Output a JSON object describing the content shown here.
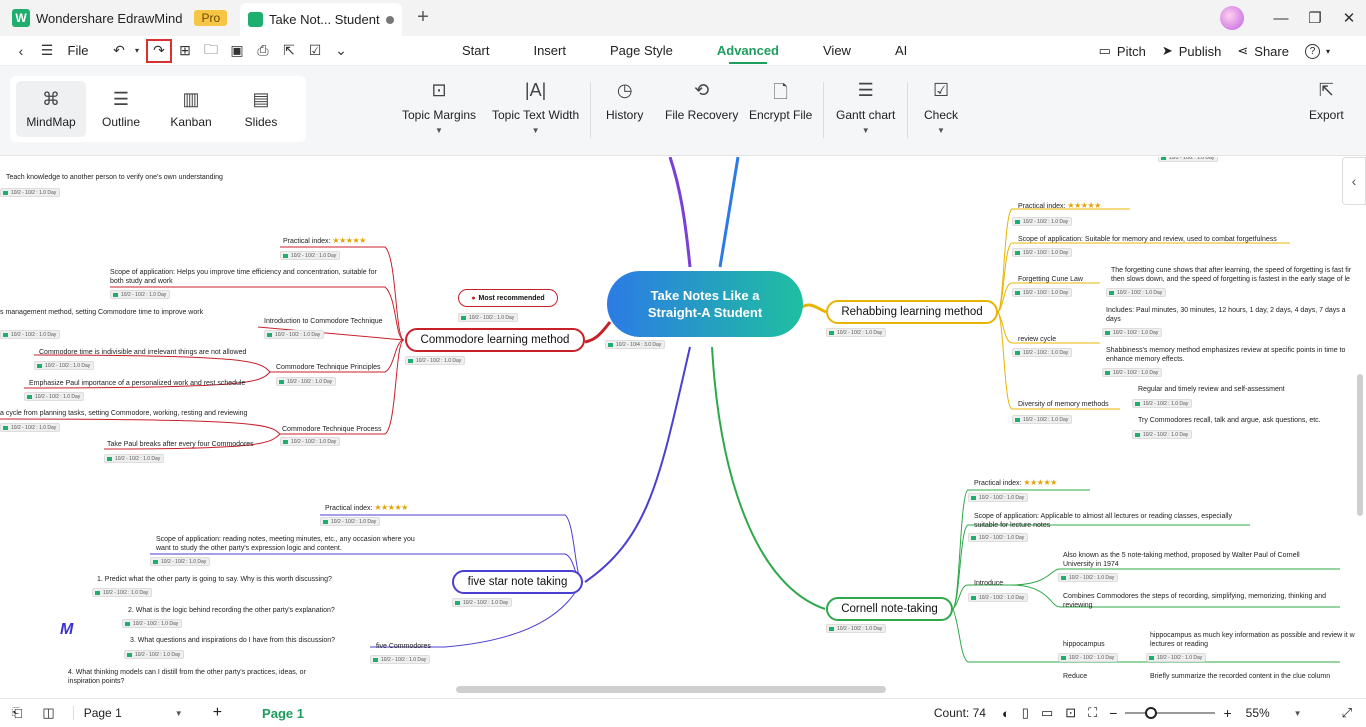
{
  "app": {
    "name": "Wondershare EdrawMind",
    "badge": "Pro",
    "doc_tab": "Take Not... Student"
  },
  "menubar": {
    "file": "File"
  },
  "menu_tabs": [
    "Start",
    "Insert",
    "Page Style",
    "Advanced",
    "View",
    "AI"
  ],
  "right_menu": {
    "pitch": "Pitch",
    "publish": "Publish",
    "share": "Share",
    "help": "?"
  },
  "views": [
    "MindMap",
    "Outline",
    "Kanban",
    "Slides"
  ],
  "ribbon": {
    "topic_margins": "Topic Margins",
    "topic_text_width": "Topic Text Width",
    "history": "History",
    "file_recovery": "File Recovery",
    "encrypt_file": "Encrypt File",
    "gantt_chart": "Gantt chart",
    "check": "Check",
    "export": "Export"
  },
  "status": {
    "page_select": "Page 1",
    "page_tab": "Page 1",
    "count": "Count: 74",
    "zoom": "55%"
  },
  "mindmap": {
    "central": "Take Notes Like a Straight-A Student",
    "central_date": "10/2 - 10/4 : 3.0 Day",
    "pill": "10/2 - 10/2 : 1.0 Day",
    "pill_day": "10/2 - 10/2 : 1.0 Day",
    "most_recommended": "Most recommended",
    "branches": {
      "commodore": "Commodore learning method",
      "rehab": "Rehabbing learning method",
      "fivestar": "five star note taking",
      "cornell": "Cornell note-taking"
    },
    "top_left": "Teach knowledge to another person to verify one's own understanding",
    "practical_index": "Practical index:",
    "c": {
      "scope": "Scope of application: Helps you improve time efficiency and concentration, suitable for",
      "scope2": "both study and work",
      "mgmt": "s management method, setting Commodore time to improve work",
      "intro": "Introduction to Commodore Technique",
      "indiv": "Commodore time is indivisible and irrelevant things are not allowed",
      "principles": "Commodore Technique Principles",
      "emph": "Emphasize Paul importance of a personalized work and rest schedule",
      "cycle": "a cycle from planning tasks, setting Commodore, working, resting and reviewing",
      "process": "Commodore Technique Process",
      "breaks": "Take Paul breaks after every four Commodores"
    },
    "r": {
      "scope": "Scope of application: Suitable for memory and review, used to combat forgetfulness",
      "curve": "Forgetting Cune Law",
      "curve_d1": "The forgetting cune shows that after learning, the speed of forgetting is fast fir",
      "curve_d2": "then slows down, and the speed of forgetting is fastest in the early stage of le",
      "cycle": "review cycle",
      "inc1": "Includes: Paul minutes, 30 minutes, 12 hours, 1 day, 2 days, 4 days, 7 days a",
      "inc2": "days",
      "sh1": "Shabbiness's memory method emphasizes review at specific points in time to",
      "sh2": "enhance memory effects.",
      "div": "Diversity of memory methods",
      "reg": "Regular and timely review and self-assessment",
      "try": "Try Commodores recall, talk and argue, ask questions, etc."
    },
    "f": {
      "scope1": "Scope of application: reading notes, meeting minutes, etc., any occasion where you",
      "scope2": "want to study the other party's expression logic and content.",
      "q1": "1. Predict what the other party is going to say. Why is this worth discussing?",
      "q2": "2. What is the logic behind recording the other party's explanation?",
      "q3": "3. What questions and inspirations do I have from this discussion?",
      "five": "five Commodores",
      "q4a": "4. What thinking models can I distill from the other party's practices, ideas, or",
      "q4b": "inspiration points?"
    },
    "k": {
      "scope1": "Scope of application: Applicable to almost all lectures or reading classes, especially",
      "scope2": "suitable for lecture notes",
      "introduce": "Introduce",
      "aka1": "Also known as the 5 note-taking method, proposed by Walter Paul of Cornell",
      "aka2": "University in 1974",
      "comb1": "Combines Commodores the steps of recording, simplifying, memorizing, thinking and",
      "comb2": "reviewing",
      "hippo": "hippocampus",
      "hippo_d1": "hippocampus as much key information as possible and review it w",
      "hippo_d2": "lectures or reading",
      "reduce": "Reduce",
      "reduce_d": "Briefly summarize the recorded content in the clue column"
    }
  },
  "colors": {
    "accent": "#1f9d5e",
    "commodore": "#c8202a",
    "rehab": "#e8b400",
    "fivestar": "#4a3fd1",
    "cornell": "#2fa84a",
    "purple": "#7a3fd6",
    "blue": "#2c7be5"
  }
}
